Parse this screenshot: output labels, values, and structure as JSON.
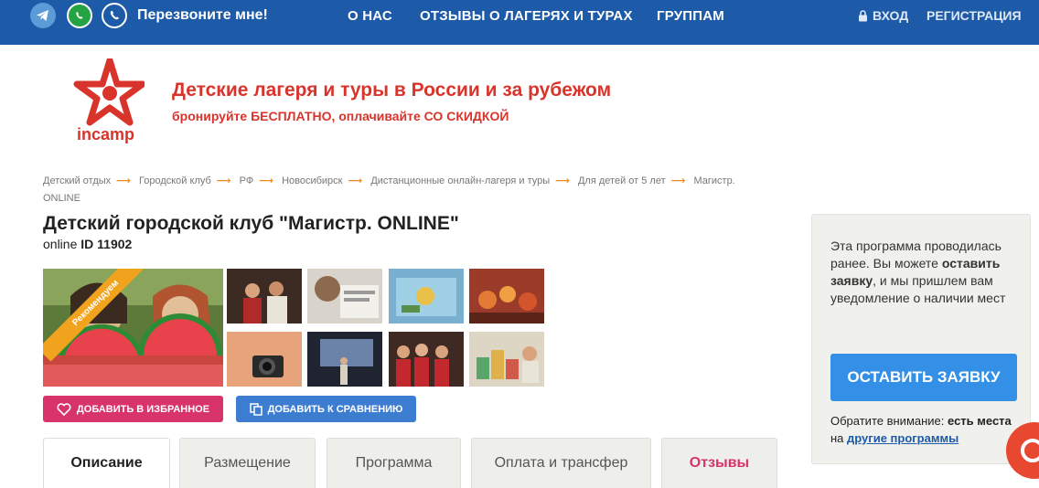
{
  "topbar": {
    "callback": "Перезвоните мне!",
    "nav": {
      "about": "О НАС",
      "reviews": "ОТЗЫВЫ О ЛАГЕРЯХ И ТУРАХ",
      "groups": "ГРУППАМ"
    },
    "login": "ВХОД",
    "register": "РЕГИСТРАЦИЯ",
    "icons": [
      "telegram-icon",
      "whatsapp-icon",
      "phone-icon",
      "lock-icon"
    ]
  },
  "brand": {
    "logo_text": "incamp",
    "title": "Детские лагеря и туры в России и за рубежом",
    "subtitle": "бронируйте БЕСПЛАТНО, оплачивайте СО СКИДКОЙ",
    "color": "#d9342b"
  },
  "breadcrumbs": [
    "Детский отдых",
    "Городской клуб",
    "РФ",
    "Новосибирск",
    "Дистанционные онлайн-лагеря и туры",
    "Для детей от 5 лет",
    "Магистр. ONLINE"
  ],
  "listing": {
    "title": "Детский городской клуб \"Магистр. ONLINE\"",
    "location": "online",
    "id_label": "ID 11902",
    "ribbon": "Рекомендуем"
  },
  "actions": {
    "favorite": "ДОБАВИТЬ В ИЗБРАННОЕ",
    "compare": "ДОБАВИТЬ К СРАВНЕНИЮ"
  },
  "tabs": [
    {
      "label": "Описание"
    },
    {
      "label": "Размещение"
    },
    {
      "label": "Программа"
    },
    {
      "label": "Оплата и трансфер"
    },
    {
      "label": "Отзывы"
    }
  ],
  "sidebar": {
    "text_1": "Эта программа проводилась ранее. Вы можете ",
    "text_bold": "оставить заявку",
    "text_2": ", и мы пришлем вам уведомление о наличии мест",
    "button": "ОСТАВИТЬ ЗАЯВКУ",
    "note_1": "Обратите внимание: ",
    "note_bold": "есть места",
    "note_2": " на ",
    "note_link": "другие программы"
  },
  "colors": {
    "topbar": "#1d5aa8",
    "accent_red": "#d9342b",
    "favorite_btn": "#d9336b",
    "compare_btn": "#3d7dd1",
    "apply_btn": "#3490e6"
  }
}
